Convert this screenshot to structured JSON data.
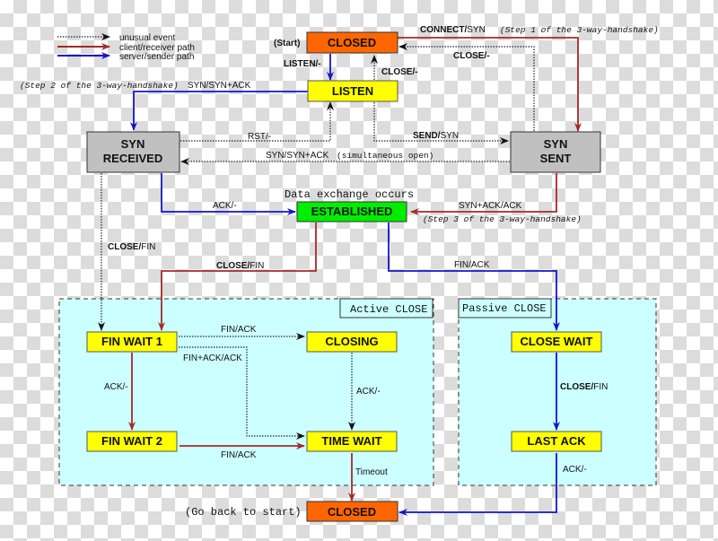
{
  "legend": {
    "items": [
      {
        "label": "unusual event",
        "style": "dotted",
        "color": "#222222"
      },
      {
        "label": "client/receiver path",
        "style": "solid",
        "color": "#a52a2a"
      },
      {
        "label": "server/sender path",
        "style": "solid",
        "color": "#1515c8"
      }
    ]
  },
  "colors": {
    "closed": "#ff6600",
    "listen_yellow": "#ffff00",
    "syn_grey": "#c0c0c0",
    "established": "#00ee00",
    "region_fill": "#ccffff",
    "client_path": "#a52a2a",
    "server_path": "#1515c8",
    "unusual": "#222222"
  },
  "states": {
    "closed_top": "CLOSED",
    "listen": "LISTEN",
    "syn_received_line1": "SYN",
    "syn_received_line2": "RECEIVED",
    "syn_sent_line1": "SYN",
    "syn_sent_line2": "SENT",
    "established": "ESTABLISHED",
    "fin_wait_1": "FIN WAIT 1",
    "fin_wait_2": "FIN WAIT 2",
    "closing": "CLOSING",
    "time_wait": "TIME WAIT",
    "close_wait": "CLOSE WAIT",
    "last_ack": "LAST ACK",
    "closed_bottom": "CLOSED"
  },
  "annotations": {
    "start": "(Start)",
    "go_back": "(Go back to start)",
    "data_exchange": "Data exchange occurs",
    "step1": "(Step 1 of the 3-way-handshake)",
    "step2": "(Step 2 of the 3-way-handshake)",
    "step3": "(Step 3 of the 3-way-handshake)",
    "simultaneous": "(simultaneous open)",
    "active_close": "Active CLOSE",
    "passive_close": "Passive CLOSE"
  },
  "transitions": {
    "connect_bold": "CONNECT/",
    "connect_rest": "SYN",
    "listen": "LISTEN/-",
    "close_listen": "CLOSE/-",
    "close_synsent": "CLOSE/-",
    "syn_synack": "SYN/SYN+ACK",
    "rst": "RST/-",
    "send_bold": "SEND/",
    "send_rest": "SYN",
    "syn_synack_simul": "SYN/SYN+ACK",
    "ack_synrcvd": "ACK/-",
    "synack_ack": "SYN+ACK/ACK",
    "close_fin_synrcvd_bold": "CLOSE/",
    "close_fin_synrcvd_rest": "FIN",
    "close_fin_est_bold": "CLOSE/",
    "close_fin_est_rest": "FIN",
    "fin_ack_est": "FIN/ACK",
    "fin_ack_fw1": "FIN/ACK",
    "finack_ack": "FIN+ACK/ACK",
    "ack_fw1": "ACK/-",
    "ack_closing": "ACK/-",
    "fin_ack_fw2": "FIN/ACK",
    "timeout": "Timeout",
    "close_fin_cw_bold": "CLOSE/",
    "close_fin_cw_rest": "FIN",
    "ack_lastack": "ACK/-"
  }
}
